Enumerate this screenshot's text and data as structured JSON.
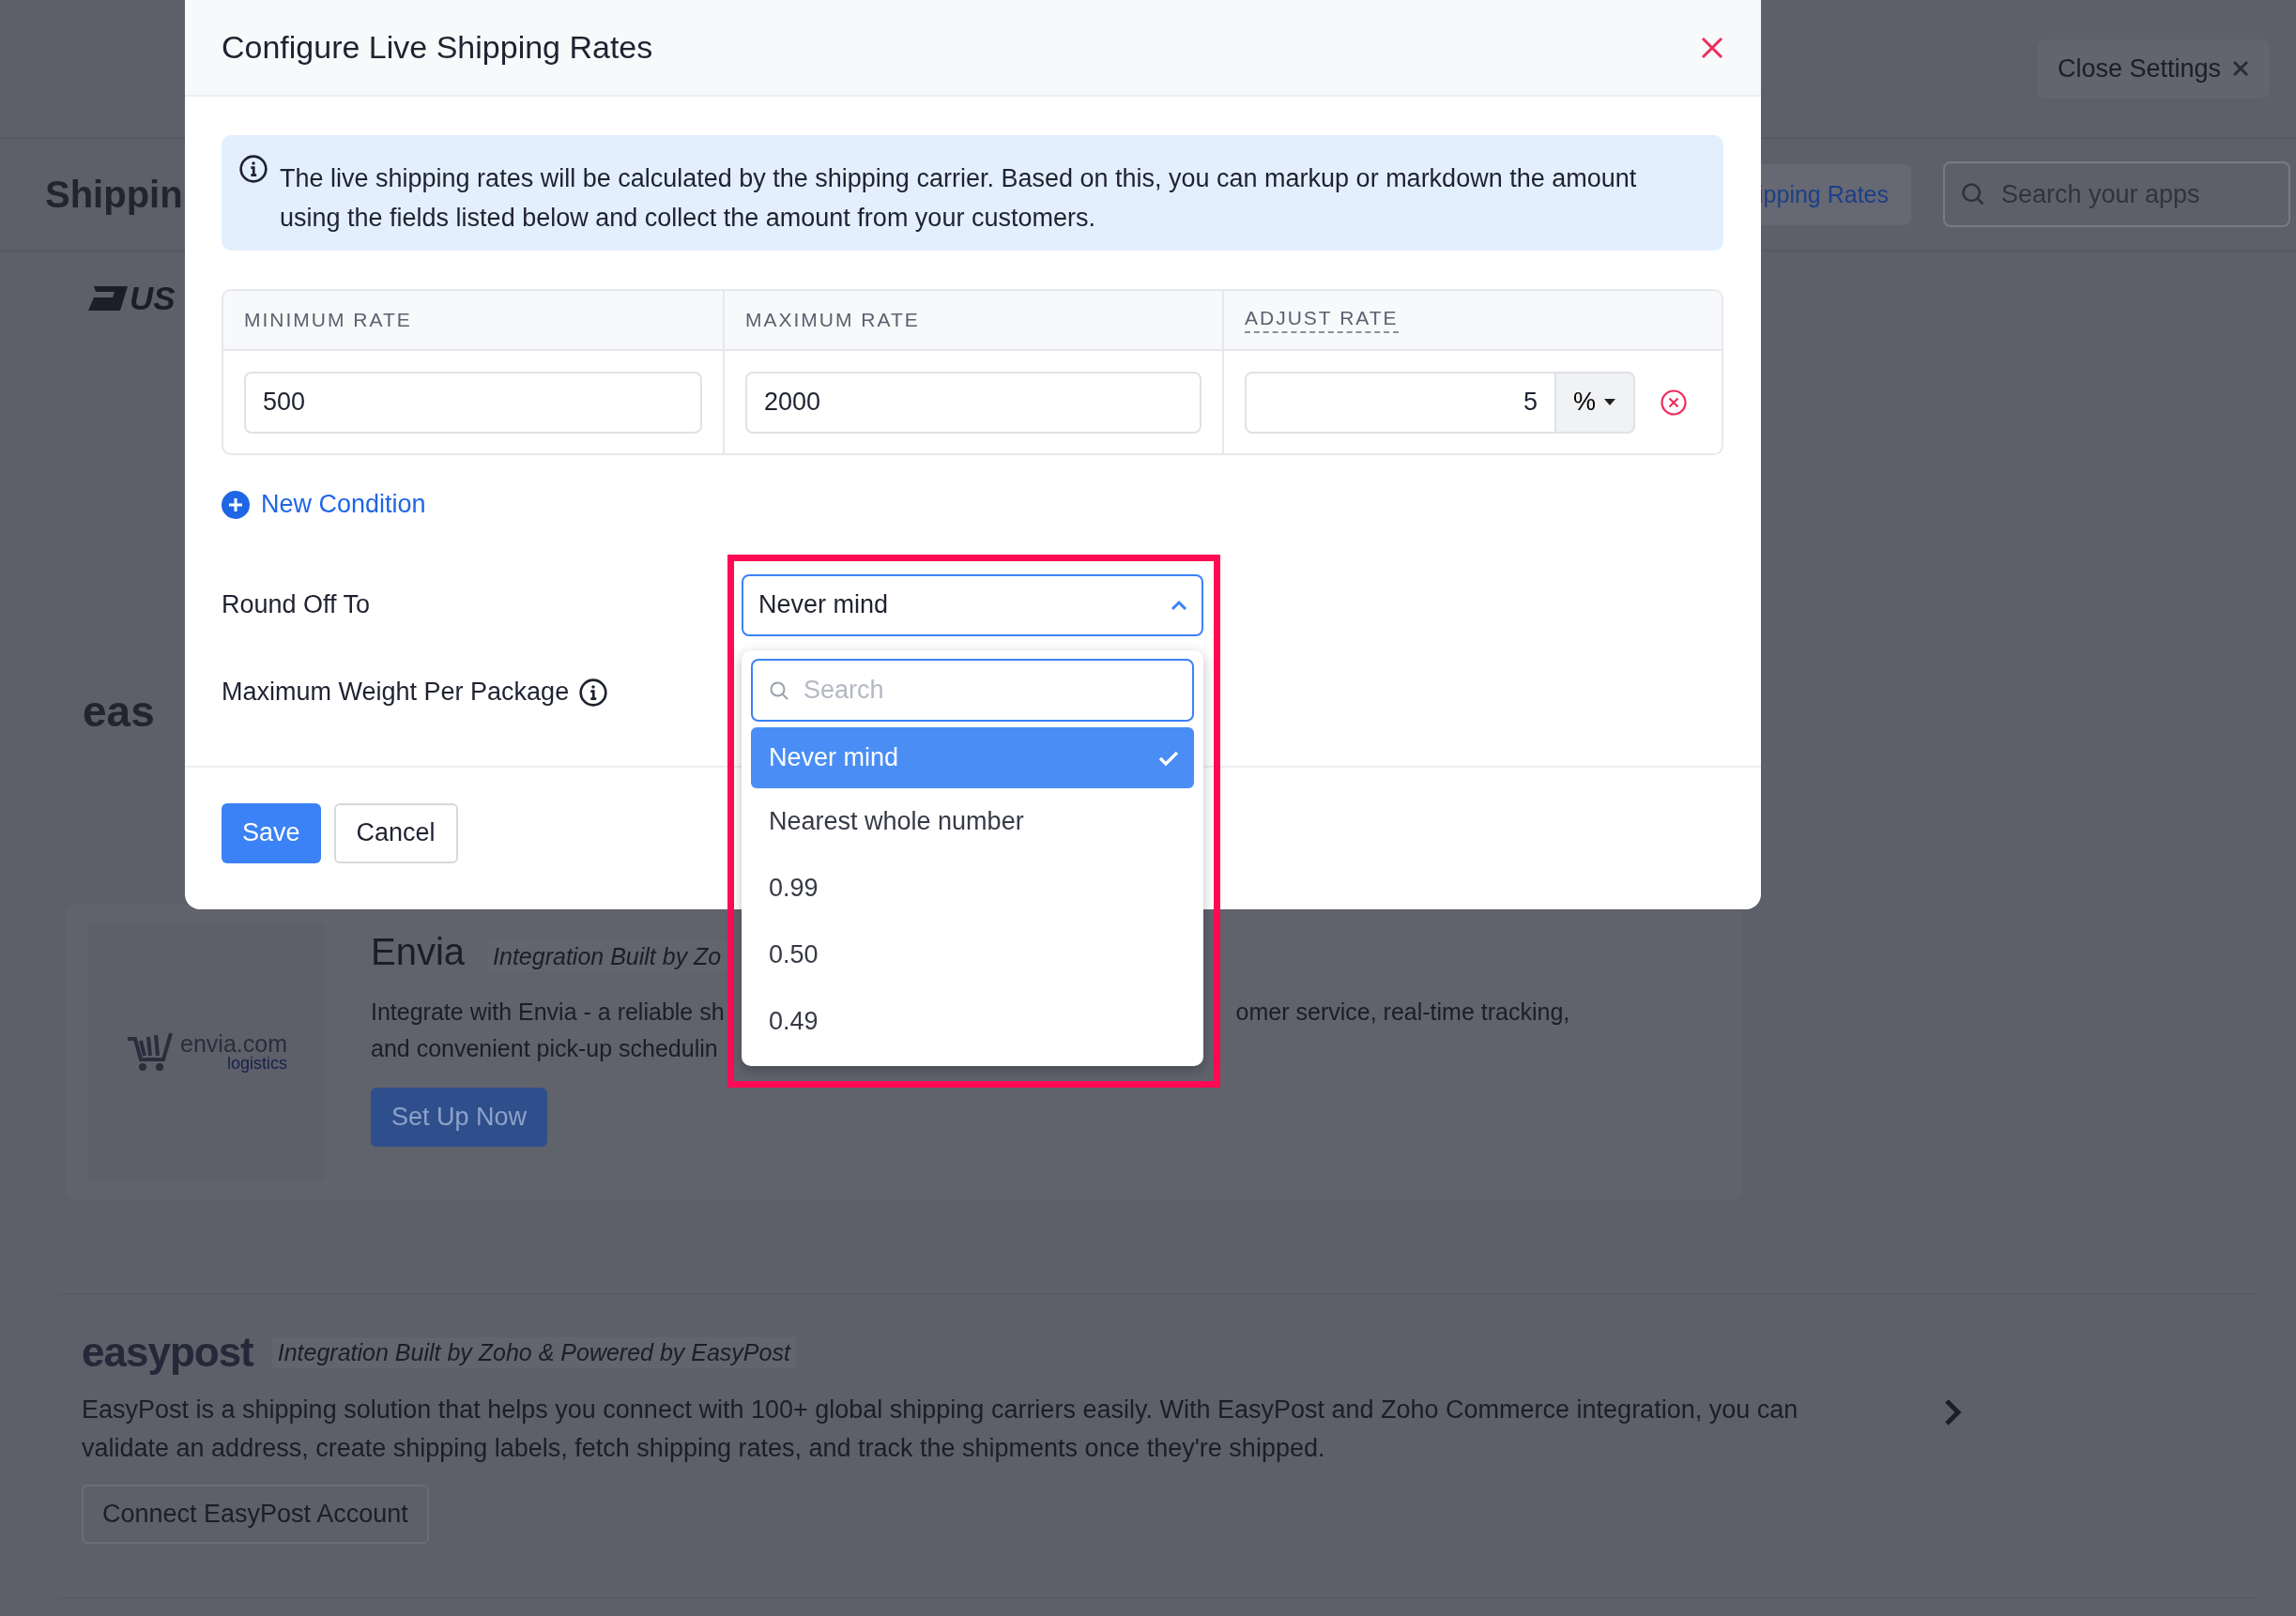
{
  "background": {
    "close_settings": "Close Settings",
    "page_title": "Shippin",
    "tab": {
      "label": "ipping Rates",
      "selected": true
    },
    "search": {
      "placeholder": "Search your apps"
    },
    "side_cards": [
      {
        "kind": "usps",
        "logo_text": "US"
      },
      {
        "kind": "wordmark",
        "logo_text": "eas"
      }
    ],
    "envia": {
      "logo_text": "envia.com",
      "logo_subtext": "logistics",
      "name": "Envia",
      "tagline": "Integration Built by Zo",
      "description_lines": [
        [
          "Integrate with Envia - a reliable sh",
          "omer service, real-time tracking,"
        ],
        [
          "and convenient pick-up schedulin"
        ]
      ],
      "button": "Set Up Now"
    },
    "easypost": {
      "logo_text": "easypost",
      "tagline": "Integration Built by Zoho & Powered by EasyPost",
      "description": "EasyPost is a shipping solution that helps you connect with 100+ global shipping carriers easily. With EasyPost and Zoho Commerce integration, you can validate an address, create shipping labels, fetch shipping rates, and track the shipments once they're shipped.",
      "button": "Connect EasyPost Account"
    }
  },
  "modal": {
    "title": "Configure Live Shipping Rates",
    "info": "The live shipping rates will be calculated by the shipping carrier. Based on this, you can markup or markdown the amount using the fields listed below and collect the amount from your customers.",
    "columns": [
      "MINIMUM RATE",
      "MAXIMUM RATE",
      "ADJUST RATE"
    ],
    "conditions": [
      {
        "minimum": "500",
        "maximum": "2000",
        "adjust": "5",
        "unit": "%"
      }
    ],
    "new_condition": "New Condition",
    "fields": [
      {
        "label": "Round Off To",
        "info": false
      },
      {
        "label": "Maximum Weight Per Package",
        "info": true
      }
    ],
    "round_off": {
      "value": "Never mind",
      "expanded": true,
      "highlighted": true,
      "search_placeholder": "Search",
      "options": [
        {
          "label": "Never mind",
          "selected": true
        },
        {
          "label": "Nearest whole number",
          "selected": false
        },
        {
          "label": "0.99",
          "selected": false
        },
        {
          "label": "0.50",
          "selected": false
        },
        {
          "label": "0.49",
          "selected": false
        }
      ]
    },
    "buttons": {
      "save": "Save",
      "cancel": "Cancel"
    }
  }
}
